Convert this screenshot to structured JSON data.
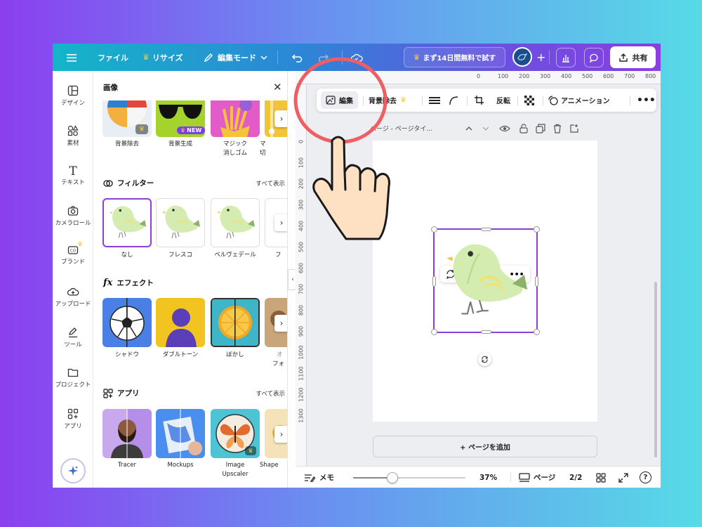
{
  "topbar": {
    "menu_icon": "hamburger-icon",
    "file": "ファイル",
    "resize": "リサイズ",
    "edit_mode": "編集モード",
    "trial": "まず14日間無料で試す",
    "share": "共有",
    "gradient_colors": [
      "#14b5c9",
      "#6c4fe0",
      "#8a3fe0"
    ]
  },
  "rail": {
    "items": [
      {
        "label": "デザイン",
        "icon": "layout-icon"
      },
      {
        "label": "素材",
        "icon": "shapes-icon"
      },
      {
        "label": "テキスト",
        "icon": "text-icon"
      },
      {
        "label": "カメラロール",
        "icon": "camera-icon"
      },
      {
        "label": "ブランド",
        "icon": "brand-icon"
      },
      {
        "label": "アップロード",
        "icon": "upload-cloud-icon"
      },
      {
        "label": "ツール",
        "icon": "pen-icon"
      },
      {
        "label": "プロジェクト",
        "icon": "folder-icon"
      },
      {
        "label": "アプリ",
        "icon": "apps-icon"
      }
    ],
    "magic_icon": "sparkle-icon"
  },
  "panel": {
    "title": "画像",
    "top_row": [
      {
        "line1": "背景除去",
        "line2": ""
      },
      {
        "line1": "背景生成",
        "line2": ""
      },
      {
        "line1": "マジック",
        "line2": "消しゴム"
      },
      {
        "line1": "マ",
        "line2": "切"
      }
    ],
    "new_badge": "NEW",
    "filters": {
      "title": "フィルター",
      "see_all": "すべて表示",
      "items": [
        "なし",
        "フレスコ",
        "ベルヴェデール",
        "フ"
      ]
    },
    "effects": {
      "title": "エフェクト",
      "items": [
        {
          "line1": "シャドウ",
          "line2": ""
        },
        {
          "line1": "ダブルトーン",
          "line2": ""
        },
        {
          "line1": "ぼかし",
          "line2": ""
        },
        {
          "line1": "オ",
          "line2": "フォ"
        }
      ]
    },
    "apps": {
      "title": "アプリ",
      "see_all": "すべて表示",
      "items": [
        {
          "line1": "Tracer",
          "line2": ""
        },
        {
          "line1": "Mockups",
          "line2": ""
        },
        {
          "line1": "Image",
          "line2": "Upscaler"
        },
        {
          "line1": "Shape",
          "line2": ""
        }
      ]
    }
  },
  "ruler": {
    "top": [
      "0",
      "100",
      "200",
      "300",
      "400",
      "500",
      "600",
      "700",
      "800"
    ],
    "left": [
      "0",
      "100",
      "200",
      "300",
      "400",
      "500",
      "600",
      "700",
      "800",
      "900",
      "1000",
      "1100",
      "1200",
      "1300"
    ]
  },
  "context_toolbar": {
    "edit": "編集",
    "remove_bg": "背景除去",
    "flip": "反転",
    "animation": "アニメーション"
  },
  "page_header": {
    "title": "ページ - ページタイ..."
  },
  "add_page": "+ ページを追加",
  "bottombar": {
    "notes": "メモ",
    "zoom": "37%",
    "zoom_fraction": 0.37,
    "pages_label": "ページ",
    "page_count": "2/2"
  }
}
